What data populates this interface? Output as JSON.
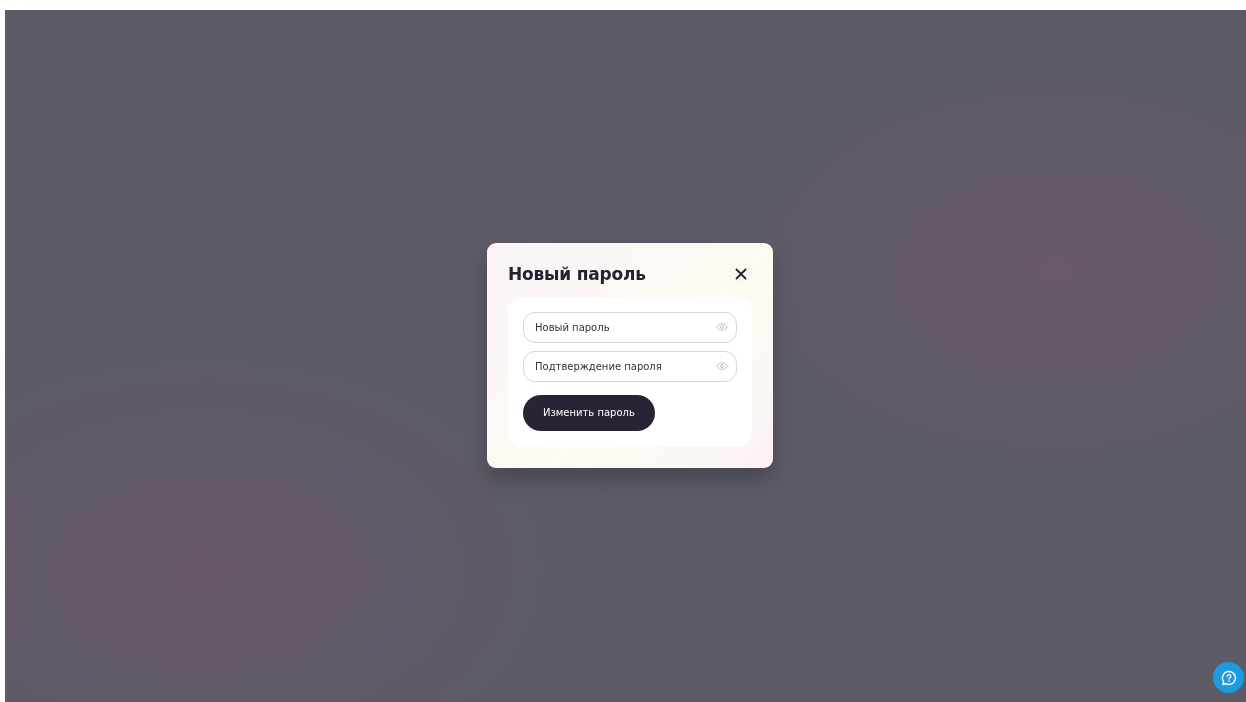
{
  "dialog": {
    "title": "Новый пароль",
    "fields": [
      {
        "placeholder": "Новый пароль"
      },
      {
        "placeholder": "Подтверждение пароля"
      }
    ],
    "submit_button": "Изменить пароль"
  }
}
